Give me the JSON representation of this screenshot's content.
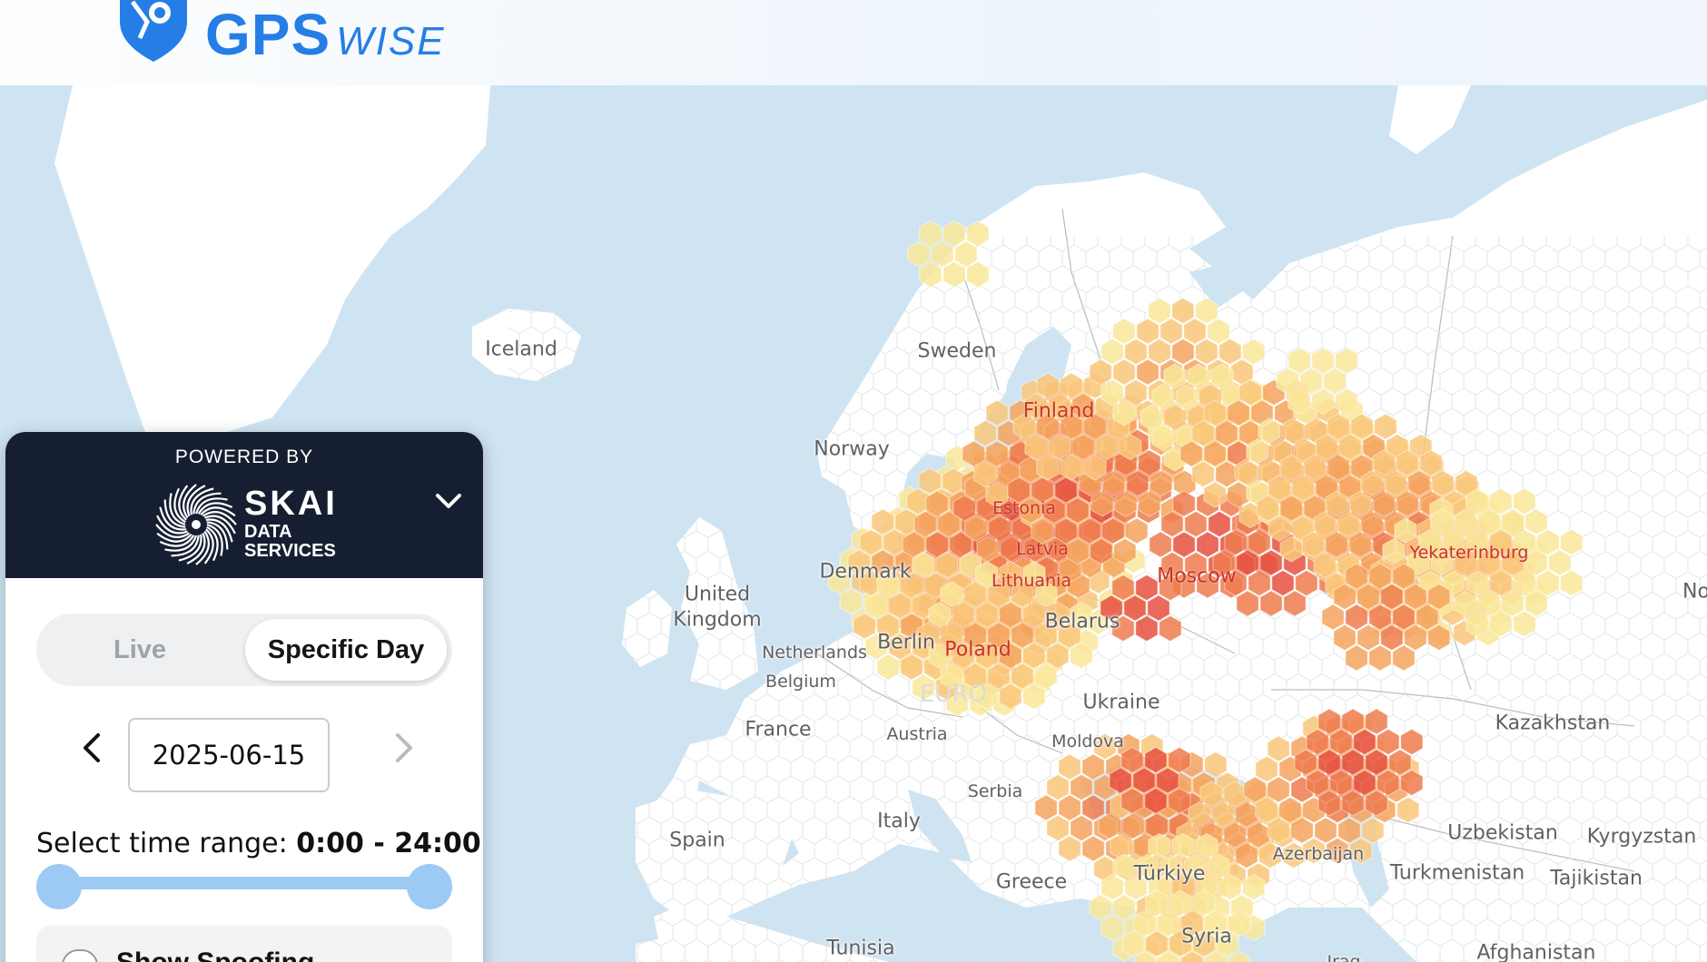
{
  "header": {
    "logo_gps": "GPS",
    "logo_wise": "WISE",
    "brand_color": "#1f7ae6"
  },
  "map": {
    "land_color": "#ffffff",
    "water_color": "#cfe4f2",
    "labels": [
      {
        "text": "Iceland"
      },
      {
        "text": "Sweden"
      },
      {
        "text": "Norway"
      },
      {
        "text": "Finland"
      },
      {
        "text": "Estonia"
      },
      {
        "text": "Latvia"
      },
      {
        "text": "Lithuania"
      },
      {
        "text": "Denmark"
      },
      {
        "text": "United"
      },
      {
        "text": "Kingdom"
      },
      {
        "text": "Netherlands"
      },
      {
        "text": "Belgium"
      },
      {
        "text": "Berlin"
      },
      {
        "text": "Poland"
      },
      {
        "text": "Belarus"
      },
      {
        "text": "Moscow"
      },
      {
        "text": "Yekaterinburg"
      },
      {
        "text": "Ukraine"
      },
      {
        "text": "France"
      },
      {
        "text": "Austria"
      },
      {
        "text": "Moldova"
      },
      {
        "text": "Serbia"
      },
      {
        "text": "Italy"
      },
      {
        "text": "Spain"
      },
      {
        "text": "Greece"
      },
      {
        "text": "Türkiye"
      },
      {
        "text": "Azerbaijan"
      },
      {
        "text": "Kazakhstan"
      },
      {
        "text": "Uzbekistan"
      },
      {
        "text": "Kyrgyzstan"
      },
      {
        "text": "Turkmenistan"
      },
      {
        "text": "Tajikistan"
      },
      {
        "text": "Afghanistan"
      },
      {
        "text": "Syria"
      },
      {
        "text": "Tunisia"
      },
      {
        "text": "Iraq"
      },
      {
        "text": "No"
      },
      {
        "text": "EURO"
      }
    ],
    "heat_colors": [
      "#f9e79a",
      "#f9c77a",
      "#f5a35e",
      "#ee7b4d",
      "#e6503f"
    ]
  },
  "panel": {
    "powered_by": "POWERED BY",
    "brand_name": "SKAI",
    "brand_sub_1": "DATA",
    "brand_sub_2": "SERVICES",
    "mode_live": "Live",
    "mode_specific": "Specific Day",
    "selected_mode": "Specific Day",
    "date": "2025-06-15",
    "range_label": "Select time range: ",
    "range_value": "0:00 - 24:00",
    "range_start": "0:00",
    "range_end": "24:00",
    "show_spoofing": "Show Spoofing"
  }
}
